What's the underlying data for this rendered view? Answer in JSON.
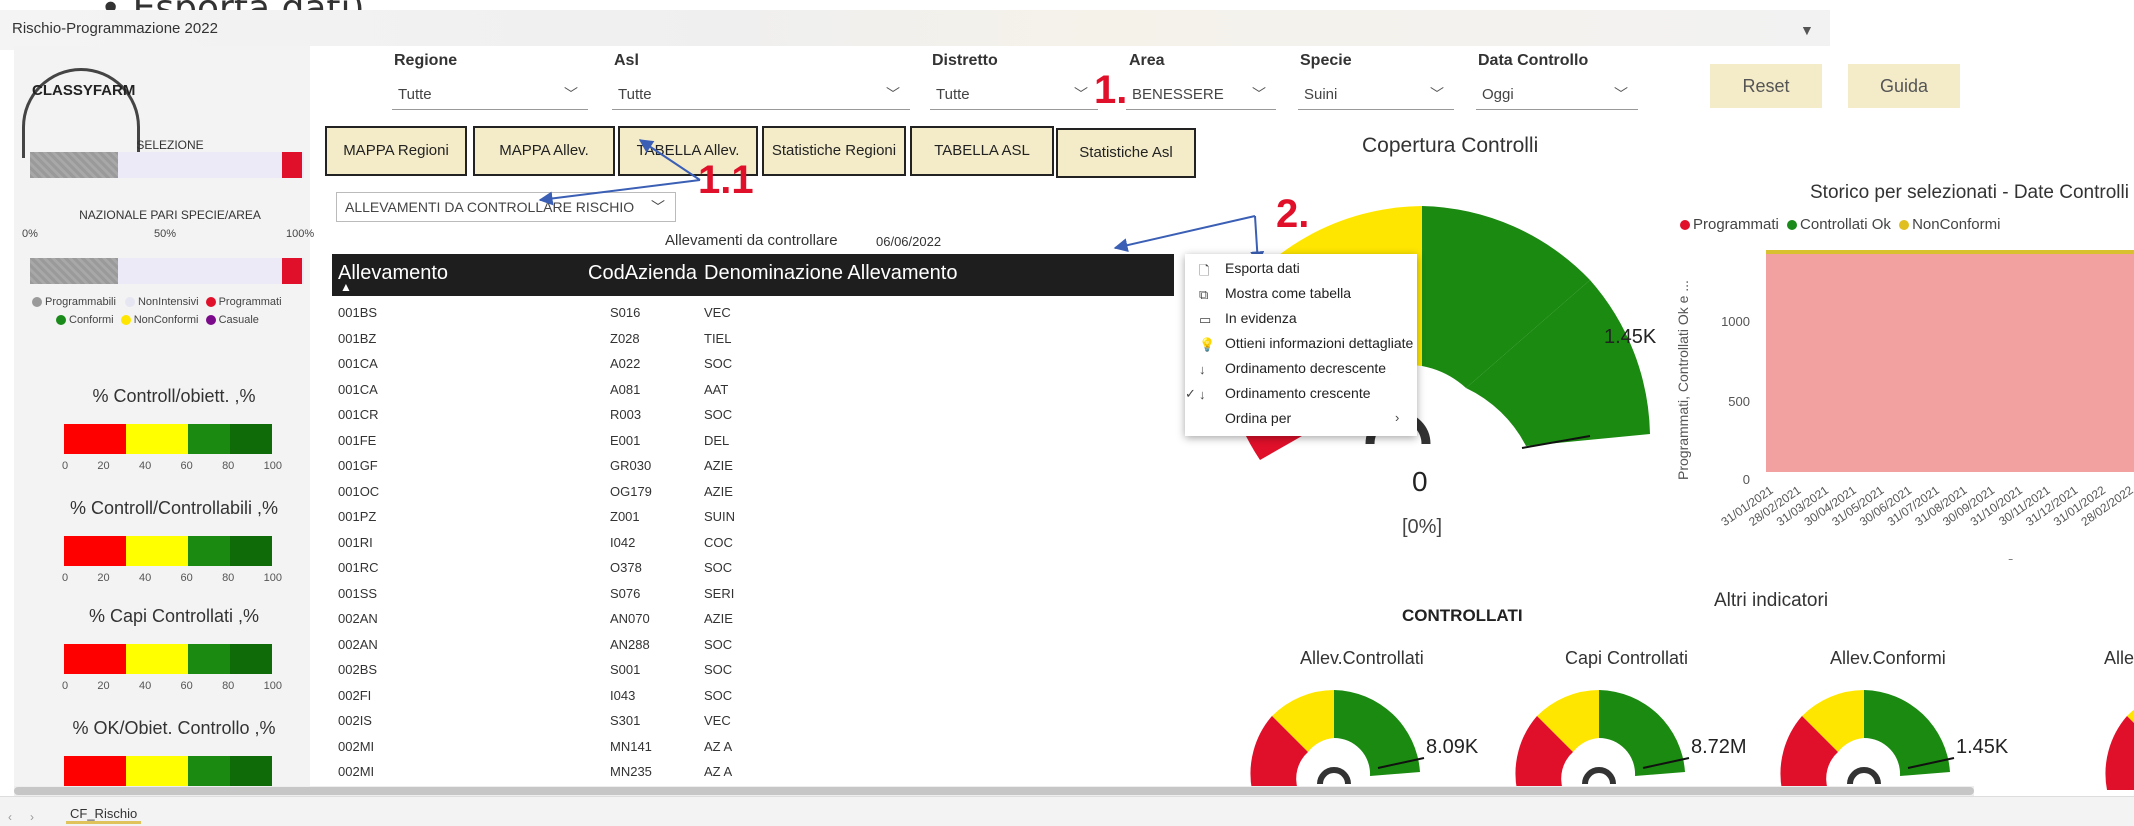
{
  "window": {
    "hint": "• Esporta dati)",
    "title": "Rischio-Programmazione 2022",
    "sheet_tab": "CF_Rischio"
  },
  "logo": {
    "text": "CLASSYFARM"
  },
  "filters": [
    {
      "label": "Regione",
      "value": "Tutte"
    },
    {
      "label": "Asl",
      "value": "Tutte"
    },
    {
      "label": "Distretto",
      "value": "Tutte"
    },
    {
      "label": "Area",
      "value": "BENESSERE"
    },
    {
      "label": "Specie",
      "value": "Suini"
    },
    {
      "label": "Data Controllo",
      "value": "Oggi"
    }
  ],
  "actions": {
    "reset": "Reset",
    "guide": "Guida"
  },
  "nav_buttons": [
    "MAPPA Regioni",
    "MAPPA Allev.",
    "TABELLA Allev.",
    "Statistiche Regioni",
    "TABELLA ASL",
    "Statistiche Asl"
  ],
  "left_panel": {
    "selezione_label": "SELEZIONE",
    "nazionale_label": "NAZIONALE PARI SPECIE/AREA",
    "axis": [
      "0%",
      "50%",
      "100%"
    ],
    "legend": [
      "Programmabili",
      "NonIntensivi",
      "Programmati",
      "Conformi",
      "NonConformi",
      "Casuale"
    ],
    "legend_colors": [
      "#9a9a9a",
      "#e6e6f2",
      "#e0102a",
      "#1a8a1a",
      "#ffe600",
      "#7a0a8a"
    ],
    "kpis": [
      {
        "title": "% Controll/obiett. ,%"
      },
      {
        "title": "% Controll/Controllabili ,%"
      },
      {
        "title": "% Capi Controllati ,%"
      },
      {
        "title": "% OK/Obiet. Controllo ,%"
      }
    ],
    "kpi_ticks": [
      "0",
      "20",
      "40",
      "60",
      "80",
      "100"
    ]
  },
  "table": {
    "dropdown": "ALLEVAMENTI DA CONTROLLARE RISCHIO",
    "title": "Allevamenti da controllare",
    "date": "06/06/2022",
    "columns": [
      "Allevamento",
      "CodAzienda",
      "Denominazione Allevamento"
    ],
    "rows": [
      [
        "001BS",
        "S016",
        "VEC"
      ],
      [
        "001BZ",
        "Z028",
        "TIEL"
      ],
      [
        "001CA",
        "A022",
        "SOC"
      ],
      [
        "001CA",
        "A081",
        "AAT"
      ],
      [
        "001CR",
        "R003",
        "SOC"
      ],
      [
        "001FE",
        "E001",
        "DEL"
      ],
      [
        "001GF",
        "GR030",
        "AZIE"
      ],
      [
        "001OC",
        "OG179",
        "AZIE"
      ],
      [
        "001PZ",
        "Z001",
        "SUIN"
      ],
      [
        "001RI",
        "I042",
        "COC"
      ],
      [
        "001RC",
        "O378",
        "SOC"
      ],
      [
        "001SS",
        "S076",
        "SERI"
      ],
      [
        "002AN",
        "AN070",
        "AZIE"
      ],
      [
        "002AN",
        "AN288",
        "SOC"
      ],
      [
        "002BS",
        "S001",
        "SOC"
      ],
      [
        "002FI",
        "I043",
        "SOC"
      ],
      [
        "002IS",
        "S301",
        "VEC"
      ],
      [
        "002MI",
        "MN141",
        "AZ A"
      ],
      [
        "002MI",
        "MN235",
        "AZ A"
      ]
    ]
  },
  "annotations": {
    "a1": "1.",
    "a11": "1.1",
    "a2": "2."
  },
  "context_menu": {
    "items": [
      "Esporta dati",
      "Mostra come tabella",
      "In evidenza",
      "Ottieni informazioni dettagliate",
      "Ordinamento decrescente",
      "Ordinamento crescente",
      "Ordina per"
    ],
    "checked_index": 5
  },
  "coverage": {
    "title": "Copertura Controlli",
    "max_label": "1.45K",
    "value": "0",
    "percent": "[0%]"
  },
  "history": {
    "title": "Storico per selezionati - Date Controlli",
    "legend": [
      "Programmati",
      "Controllati Ok",
      "NonConformi"
    ],
    "legend_colors": [
      "#e0102a",
      "#1a8a1a",
      "#e0c020"
    ],
    "y_axis_label": "Programmati, Controllati Ok e ...",
    "y_ticks": [
      "0",
      "500",
      "1000"
    ],
    "x_ticks": [
      "31/01/2021",
      "28/02/2021",
      "31/03/2021",
      "30/04/2021",
      "31/05/2021",
      "30/06/2021",
      "31/07/2021",
      "31/08/2021",
      "30/09/2021",
      "31/10/2021",
      "30/11/2021",
      "31/12/2021",
      "31/01/2022",
      "28/02/2022"
    ],
    "x_caption": "-",
    "colors": {
      "area": "#f2a0a0",
      "line": "#d8c030"
    }
  },
  "other": {
    "title": "Altri indicatori",
    "controllati": "CONTROLLATI",
    "gauges": [
      {
        "title": "Allev.Controllati",
        "value": "8.09K"
      },
      {
        "title": "Capi Controllati",
        "value": "8.72M"
      },
      {
        "title": "Allev.Conformi",
        "value": "1.45K"
      },
      {
        "title": "Alle",
        "value": ""
      }
    ]
  }
}
